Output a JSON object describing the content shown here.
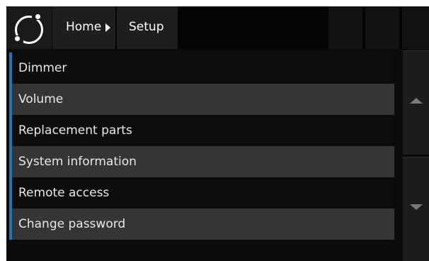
{
  "header": {
    "breadcrumb": [
      {
        "label": "Home"
      },
      {
        "label": "Setup"
      }
    ],
    "logo_icon": "ring-logo-icon",
    "separator_icon": "triangle-right-icon"
  },
  "menu": {
    "items": [
      {
        "label": "Dimmer"
      },
      {
        "label": "Volume"
      },
      {
        "label": "Replacement parts"
      },
      {
        "label": "System information"
      },
      {
        "label": "Remote access"
      },
      {
        "label": "Change password"
      }
    ]
  },
  "scroll": {
    "up_icon": "triangle-up-icon",
    "down_icon": "triangle-down-icon"
  },
  "colors": {
    "accent": "#2e6fb5",
    "background": "#0b0b0b",
    "row_alt": "#353535"
  }
}
